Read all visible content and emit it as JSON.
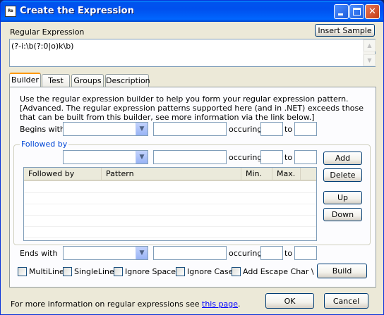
{
  "window": {
    "title": "Create the Expression",
    "app_icon_text": "Re"
  },
  "regex": {
    "label": "Regular Expression",
    "value": "(?-i:\\b(?:0|o)k\\b)",
    "insert_sample_label": "Insert Sample"
  },
  "tabs": [
    {
      "label": "Builder",
      "active": true
    },
    {
      "label": "Test",
      "active": false
    },
    {
      "label": "Groups",
      "active": false
    },
    {
      "label": "Description",
      "active": false
    }
  ],
  "builder": {
    "intro": "Use the regular expression builder to help you form your regular expression pattern.   [Advanced. The regular expression patterns supported here (and in .NET) exceeds those that can be built from this builder, see more information via the link below.]",
    "begins_with_label": "Begins with",
    "occuring_label": "occuring",
    "to_label": "to",
    "followed_by_group": "Followed by",
    "ends_with_label": "Ends with",
    "add_label": "Add",
    "delete_label": "Delete",
    "up_label": "Up",
    "down_label": "Down",
    "build_label": "Build",
    "columns": [
      "Followed by",
      "Pattern",
      "Min.",
      "Max."
    ],
    "options": [
      {
        "label": "MultiLine",
        "checked": false
      },
      {
        "label": "SingleLine",
        "checked": false
      },
      {
        "label": "Ignore Space",
        "checked": false
      },
      {
        "label": "Ignore Case",
        "checked": false
      },
      {
        "label": "Add Escape Char \\",
        "checked": false
      }
    ]
  },
  "footer": {
    "info_text": "For more information on regular expressions see ",
    "link_text": "this page",
    "info_suffix": ".",
    "ok_label": "OK",
    "cancel_label": "Cancel"
  },
  "colors": {
    "titlebar": "#0054e3",
    "window_bg": "#ece9d8",
    "group_title": "#0046d5",
    "link": "#0000ff"
  }
}
